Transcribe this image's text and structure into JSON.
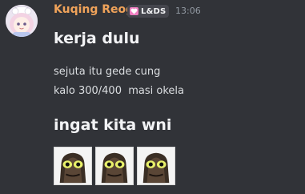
{
  "message": {
    "username": "Kuqing Reog",
    "role_tag": {
      "label": "L&DS",
      "icon": "heart-icon",
      "color": "#f07fc2"
    },
    "timestamp": "13:06",
    "lines": [
      {
        "text": "kerja dulu",
        "style": "heading"
      },
      {
        "text": "sejuta itu gede cung",
        "style": "normal"
      },
      {
        "text": "kalo 300/400  masi okela",
        "style": "normal"
      },
      {
        "text": "ingat kita wni",
        "style": "heading"
      }
    ],
    "emojis": [
      {
        "icon": "frog-emoji"
      },
      {
        "icon": "frog-emoji"
      },
      {
        "icon": "frog-emoji"
      }
    ]
  },
  "colors": {
    "background": "#313338",
    "username": "#f0a35a",
    "text": "#dbdee1",
    "timestamp": "#949ba4"
  }
}
